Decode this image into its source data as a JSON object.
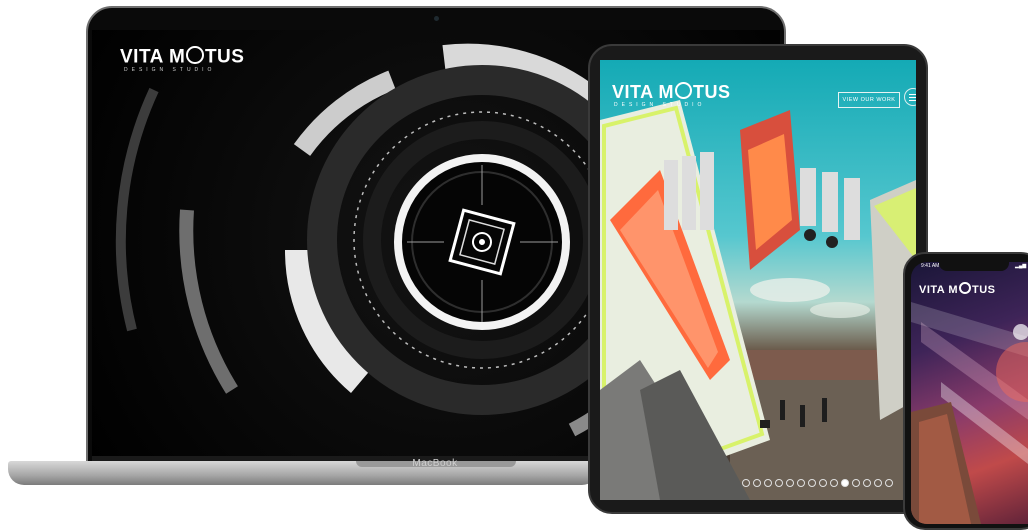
{
  "laptop": {
    "logo_main_1": "VITA M",
    "logo_main_2": "TUS",
    "logo_sub": "DESIGN STUDIO",
    "label": "MacBook"
  },
  "tablet": {
    "logo_main_1": "VITA M",
    "logo_main_2": "TUS",
    "logo_sub": "DESIGN STUDIO",
    "view_button": "VIEW OUR WORK",
    "slide_count": 14,
    "active_slide": 10
  },
  "phone": {
    "logo_main_1": "VITA M",
    "logo_main_2": "TUS",
    "status_time": "9:41 AM",
    "status_icons": "▂▄▆ ◔ ▭"
  },
  "colors": {
    "tablet_sky": "#14aab5",
    "accent_neon": "#d8f26a",
    "stage_orange": "#ff6a3d"
  }
}
